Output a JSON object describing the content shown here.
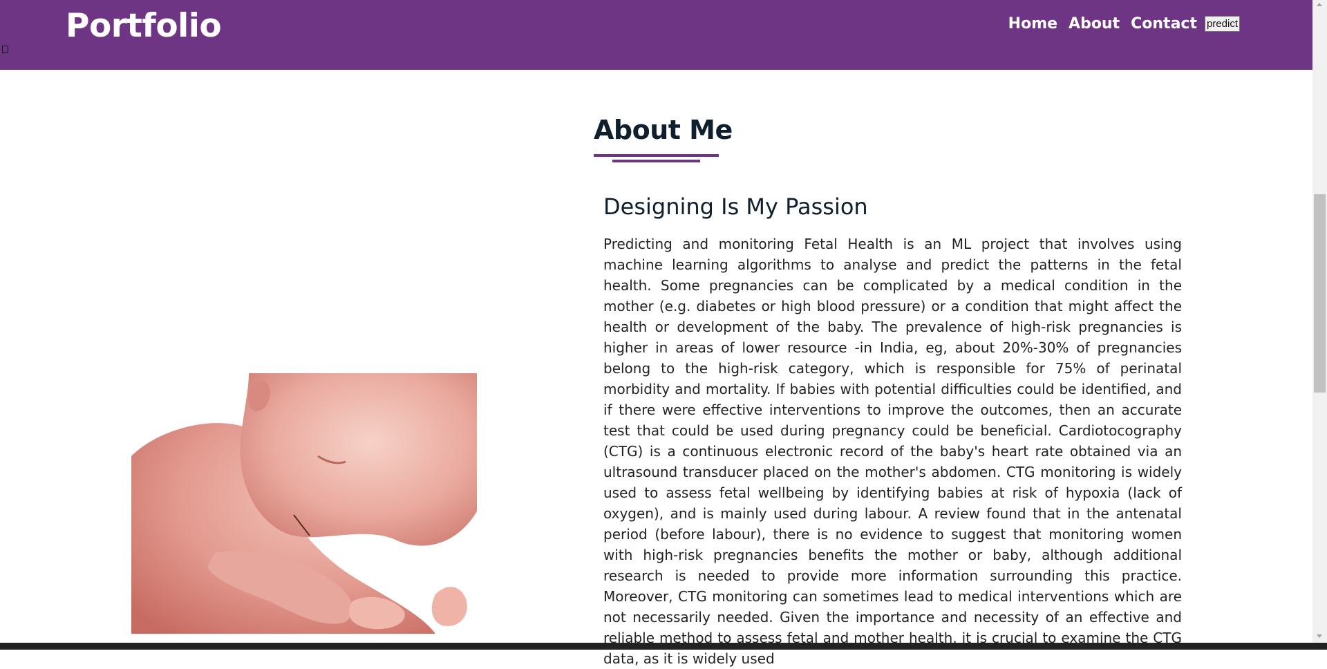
{
  "header": {
    "logo": "Portfolio",
    "nav": [
      {
        "label": "Home"
      },
      {
        "label": "About"
      },
      {
        "label": "Contact"
      }
    ],
    "predict_button": "predict",
    "background_color": "#6f3585"
  },
  "about": {
    "title": "About Me",
    "subtitle": "Designing Is My Passion",
    "paragraph": "Predicting and monitoring Fetal Health is an ML project that involves using machine learning algorithms to analyse and predict the patterns in the fetal health. Some pregnancies can be complicated by a medical condition in the mother (e.g. diabetes or high blood pressure) or a condition that might affect the health or development of the baby. The prevalence of high-risk pregnancies is higher in areas of lower resource -in India, eg, about 20%-30% of pregnancies belong to the high-risk category, which is responsible for 75% of perinatal morbidity and mortality. If babies with potential difficulties could be identified, and if there were effective interventions to improve the outcomes, then an accurate test that could be used during pregnancy could be beneficial. Cardiotocography (CTG) is a continuous electronic record of the baby's heart rate obtained via an ultrasound transducer placed on the mother's abdomen. CTG monitoring is widely used to assess fetal wellbeing by identifying babies at risk of hypoxia (lack of oxygen), and is mainly used during labour. A review found that in the antenatal period (before labour), there is no evidence to suggest that monitoring women with high-risk pregnancies benefits the mother or baby, although additional research is needed to provide more information surrounding this practice. Moreover, CTG monitoring can sometimes lead to medical interventions which are not necessarily needed. Given the importance and necessity of an effective and reliable method to assess fetal and mother health, it is crucial to examine the CTG data, as it is widely used"
  },
  "image": {
    "icon": "fetus-image"
  }
}
